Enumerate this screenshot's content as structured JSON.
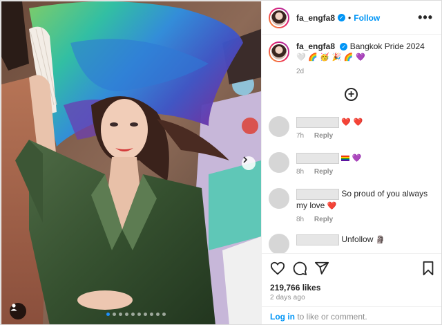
{
  "post": {
    "username": "fa_engfa8",
    "follow_label": "Follow",
    "dot_separator": "•",
    "more_label": "•••"
  },
  "caption": {
    "username": "fa_engfa8",
    "text": "Bangkok Pride 2024",
    "emoji": "🤍 🌈 🥳 🎉 🌈 💜",
    "time": "2d"
  },
  "comments": [
    {
      "text": "",
      "emoji": "❤️ ❤️",
      "time": "7h",
      "reply_label": "Reply"
    },
    {
      "text": "",
      "emoji": "💜",
      "time": "8h",
      "reply_label": "Reply"
    },
    {
      "text": "So proud of you always my love",
      "emoji": "❤️",
      "time": "8h",
      "reply_label": "Reply"
    },
    {
      "text": "Unfollow",
      "emoji": "🗿",
      "time": "",
      "reply_label": ""
    }
  ],
  "engagement": {
    "likes": "219,766 likes",
    "posted": "2 days ago"
  },
  "login_bar": {
    "login_label": "Log in",
    "suffix": " to like or comment."
  },
  "carousel": {
    "slide_count": 10,
    "active_index": 0
  },
  "colors": {
    "accent": "#0095f6",
    "heart": "#ed1c3f",
    "muted": "#8e8e8e"
  }
}
